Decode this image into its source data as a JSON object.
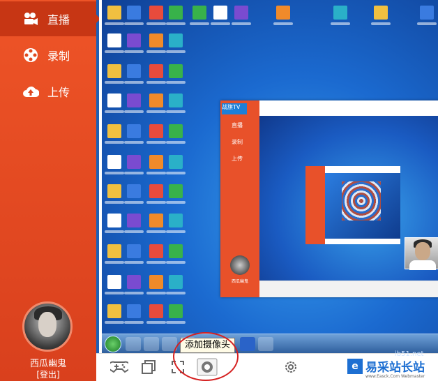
{
  "sidebar": {
    "items": [
      {
        "label": "直播",
        "icon": "camera-icon",
        "active": true
      },
      {
        "label": "录制",
        "icon": "film-reel-icon",
        "active": false
      },
      {
        "label": "上传",
        "icon": "cloud-upload-icon",
        "active": false
      }
    ],
    "user": {
      "name": "西瓜幽鬼",
      "logout": "[登出]"
    }
  },
  "nested": {
    "logo": "战旗TV",
    "items": [
      "直播",
      "录制",
      "上传"
    ],
    "username": "西瓜幽鬼"
  },
  "toolbar": {
    "tools": [
      {
        "icon": "gamepad-icon"
      },
      {
        "icon": "window-icon"
      },
      {
        "icon": "fullscreen-icon"
      },
      {
        "icon": "webcam-icon"
      },
      {
        "icon": "gear-icon"
      }
    ],
    "tooltip": "添加摄像头"
  },
  "watermark": {
    "title": "易采站长站",
    "url": "www.Easck.Com Webmaster",
    "domain": "jb51.net"
  },
  "colors": {
    "sidebar": "#e8512a",
    "active": "#c73614",
    "highlight_circle": "#d52020",
    "brand_blue": "#1d6fd2"
  }
}
